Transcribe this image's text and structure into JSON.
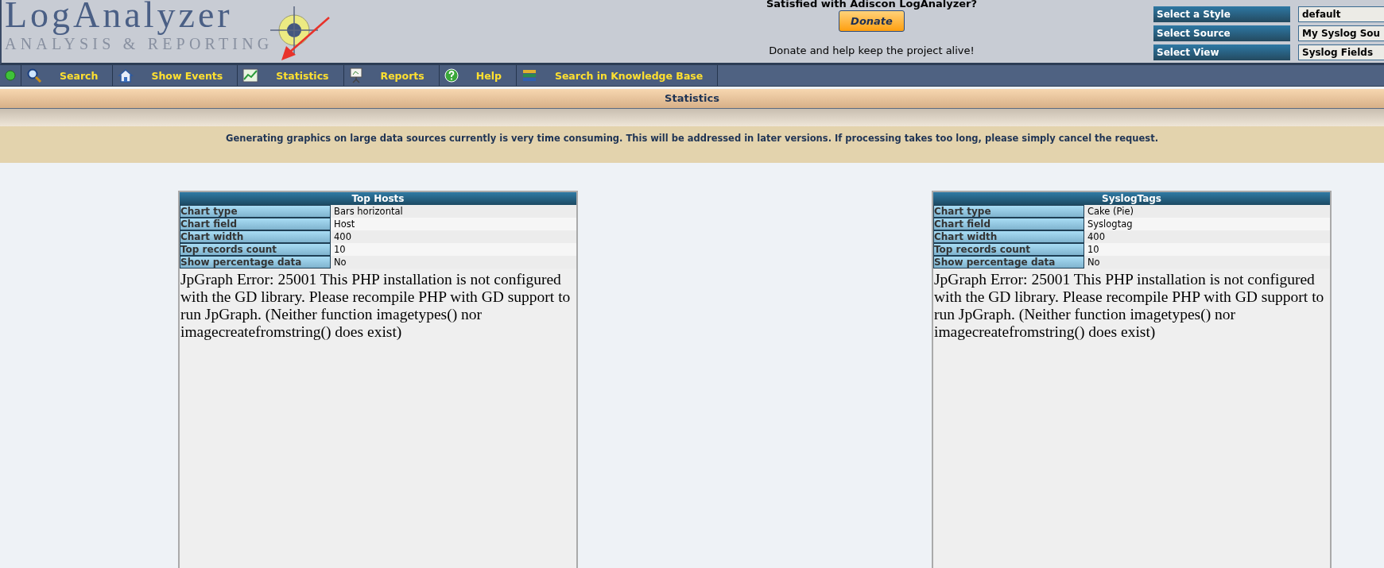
{
  "header": {
    "logo": {
      "title": "LogAnalyzer",
      "subtitle": "ANALYSIS & REPORTING"
    },
    "donate": {
      "prompt": "Satisfied with Adiscon LogAnalyzer?",
      "button": "Donate",
      "caption": "Donate and help keep the project alive!"
    },
    "selectors": [
      {
        "label": "Select a Style",
        "value": "default"
      },
      {
        "label": "Select Source",
        "value": "My Syslog Sou"
      },
      {
        "label": "Select View",
        "value": "Syslog Fields"
      }
    ]
  },
  "nav": {
    "items": [
      {
        "kind": "status"
      },
      {
        "kind": "search",
        "label": "Search"
      },
      {
        "kind": "events",
        "label": "Show Events"
      },
      {
        "kind": "statistics",
        "label": "Statistics"
      },
      {
        "kind": "reports",
        "label": "Reports"
      },
      {
        "kind": "help",
        "label": "Help"
      },
      {
        "kind": "knowledge",
        "label": "Search in Knowledge Base"
      }
    ]
  },
  "page_title": "Statistics",
  "notice": "Generating graphics on large data sources currently is very time consuming. This will be addressed in later versions. If processing takes too long, please simply cancel the request.",
  "panels": [
    {
      "title": "Top Hosts",
      "rows": [
        {
          "label": "Chart type",
          "value": "Bars horizontal"
        },
        {
          "label": "Chart field",
          "value": "Host"
        },
        {
          "label": "Chart width",
          "value": "400"
        },
        {
          "label": "Top records count",
          "value": "10"
        },
        {
          "label": "Show percentage data",
          "value": "No"
        }
      ],
      "error": "JpGraph Error: 25001 This PHP installation is not configured with the GD library. Please recompile PHP with GD support to run JpGraph. (Neither function imagetypes() nor imagecreatefromstring() does exist)"
    },
    {
      "title": "SyslogTags",
      "rows": [
        {
          "label": "Chart type",
          "value": "Cake (Pie)"
        },
        {
          "label": "Chart field",
          "value": "Syslogtag"
        },
        {
          "label": "Chart width",
          "value": "400"
        },
        {
          "label": "Top records count",
          "value": "10"
        },
        {
          "label": "Show percentage data",
          "value": "No"
        }
      ],
      "error": "JpGraph Error: 25001 This PHP installation is not configured with the GD library. Please recompile PHP with GD support to run JpGraph. (Neither function imagetypes() nor imagecreatefromstring() does exist)"
    }
  ]
}
